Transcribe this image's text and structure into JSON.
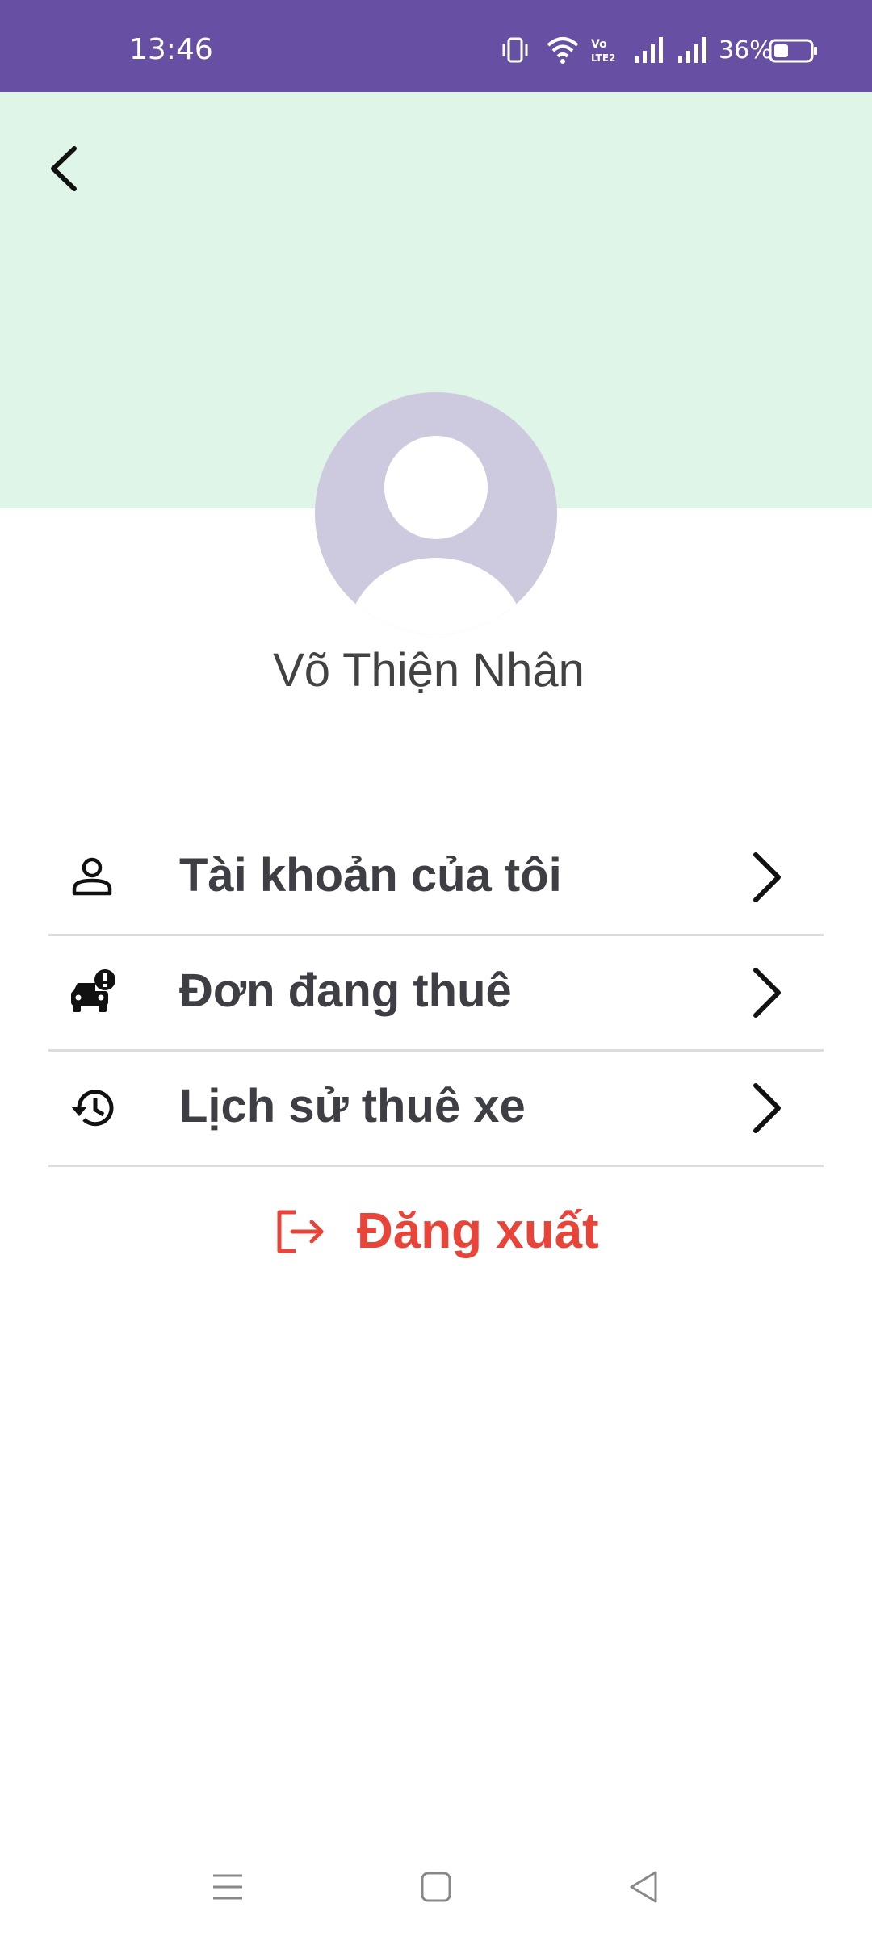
{
  "status_bar": {
    "time": "13:46",
    "battery_percent": "36%",
    "icons": [
      "vibrate-icon",
      "wifi-icon",
      "volte-icon",
      "signal-icon",
      "signal-icon",
      "battery-icon"
    ],
    "background_color": "#6750A4"
  },
  "header": {
    "background_color": "#DFF5E7",
    "back_icon": "chevron-left-icon"
  },
  "profile": {
    "name": "Võ Thiện Nhân",
    "avatar_icon": "person-placeholder-icon"
  },
  "menu": {
    "items": [
      {
        "label": "Tài khoản của tôi",
        "icon": "person-icon"
      },
      {
        "label": "Đơn đang thuê",
        "icon": "car-alert-icon"
      },
      {
        "label": "Lịch sử thuê xe",
        "icon": "history-icon"
      }
    ]
  },
  "logout": {
    "label": "Đăng xuất",
    "icon": "logout-icon",
    "color": "#E8443A"
  },
  "nav_bar": {
    "buttons": [
      "menu-icon",
      "home-icon",
      "back-icon"
    ]
  }
}
